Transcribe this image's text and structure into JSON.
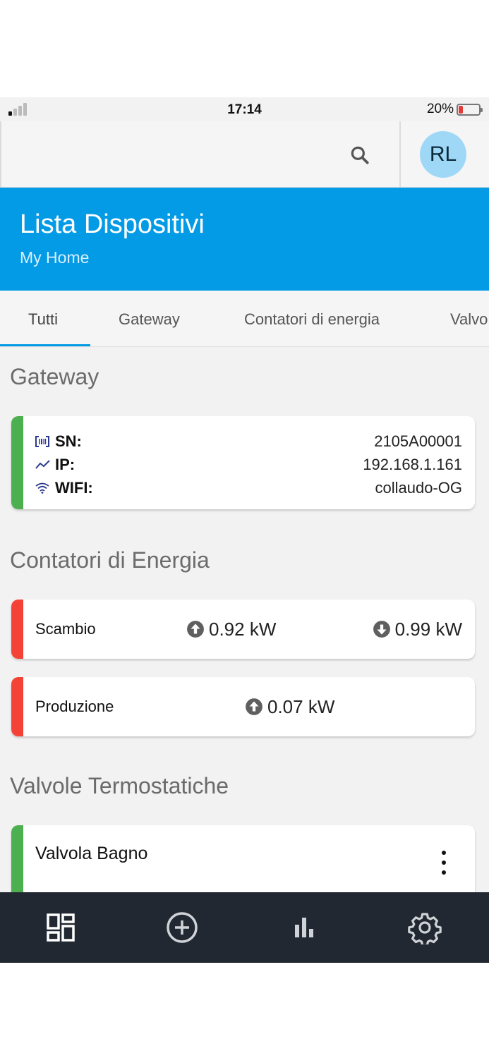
{
  "status_bar": {
    "time": "17:14",
    "battery_percent_label": "20%",
    "battery_level": 0.2,
    "signal_bars_active": 1,
    "battery_color": "#e53935"
  },
  "app_bar": {
    "search_icon": "search-icon",
    "avatar_initials": "RL",
    "avatar_color": "#9fd8f6"
  },
  "header": {
    "title": "Lista Dispositivi",
    "subtitle": "My Home",
    "color": "#039be5"
  },
  "tabs": [
    {
      "label": "Tutti",
      "active": true
    },
    {
      "label": "Gateway",
      "active": false
    },
    {
      "label": "Contatori di energia",
      "active": false
    },
    {
      "label": "Valvo",
      "active": false
    }
  ],
  "sections": {
    "gateway": {
      "title": "Gateway",
      "status_color": "#4caf50",
      "rows": [
        {
          "icon": "barcode-icon",
          "label": "SN:",
          "value": "2105A00001"
        },
        {
          "icon": "trend-line-icon",
          "label": "IP:",
          "value": "192.168.1.161"
        },
        {
          "icon": "wifi-icon",
          "label": "WIFI:",
          "value": "collaudo-OG"
        }
      ]
    },
    "energy": {
      "title": "Contatori di Energia",
      "status_color": "#f44336",
      "meters": [
        {
          "name": "Scambio",
          "up": {
            "icon": "arrow-up-circle-icon",
            "value": "0.92 kW"
          },
          "down": {
            "icon": "arrow-down-circle-icon",
            "value": "0.99 kW"
          }
        },
        {
          "name": "Produzione",
          "up": {
            "icon": "arrow-up-circle-icon",
            "value": "0.07 kW"
          }
        }
      ]
    },
    "valves": {
      "title": "Valvole Termostatiche",
      "status_color": "#4caf50",
      "items": [
        {
          "name": "Valvola Bagno",
          "menu_icon": "more-vertical-icon"
        }
      ]
    }
  },
  "bottom_nav": [
    {
      "icon": "dashboard-icon",
      "active": true
    },
    {
      "icon": "add-circle-icon",
      "active": false
    },
    {
      "icon": "bar-chart-icon",
      "active": false
    },
    {
      "icon": "gear-icon",
      "active": false
    }
  ]
}
